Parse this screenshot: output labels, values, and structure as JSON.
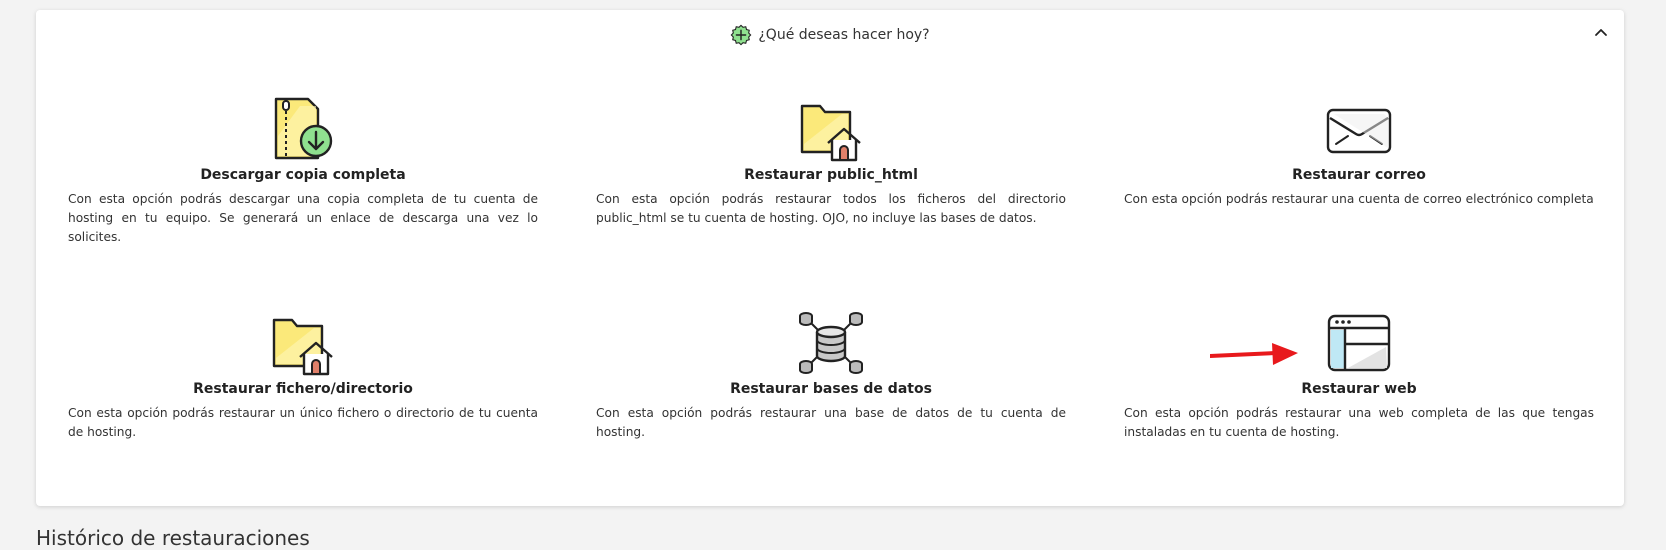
{
  "header": {
    "title": "¿Qué deseas hacer hoy?",
    "icon": "plus-badge-icon",
    "collapse_icon": "chevron-up-icon"
  },
  "options": [
    {
      "title": "Descargar copia completa",
      "description": "Con esta opción podrás descargar una copia completa de tu cuenta de hosting en tu equipo. Se generará un enlace de descarga una vez lo solicites.",
      "icon": "zip-download-icon"
    },
    {
      "title": "Restaurar public_html",
      "description": "Con esta opción podrás restaurar todos los ficheros del directorio public_html se tu cuenta de hosting. OJO, no incluye las bases de datos.",
      "icon": "folder-home-icon"
    },
    {
      "title": "Restaurar correo",
      "description": "Con esta opción podrás restaurar una cuenta de correo electrónico completa",
      "icon": "envelope-icon"
    },
    {
      "title": "Restaurar fichero/directorio",
      "description": "Con esta opción podrás restaurar un único fichero o directorio de tu cuenta de hosting.",
      "icon": "folder-home-icon"
    },
    {
      "title": "Restaurar bases de datos",
      "description": "Con esta opción podrás restaurar una base de datos de tu cuenta de hosting.",
      "icon": "database-network-icon"
    },
    {
      "title": "Restaurar web",
      "description": "Con esta opción podrás restaurar una web completa de las que tengas instaladas en tu cuenta de hosting.",
      "icon": "browser-window-icon"
    }
  ],
  "annotation": {
    "icon": "red-arrow-icon",
    "color": "#e8191c"
  },
  "history": {
    "title": "Histórico de restauraciones"
  },
  "colors": {
    "folder_yellow": "#fbe97a",
    "plus_green": "#8fe08f"
  }
}
